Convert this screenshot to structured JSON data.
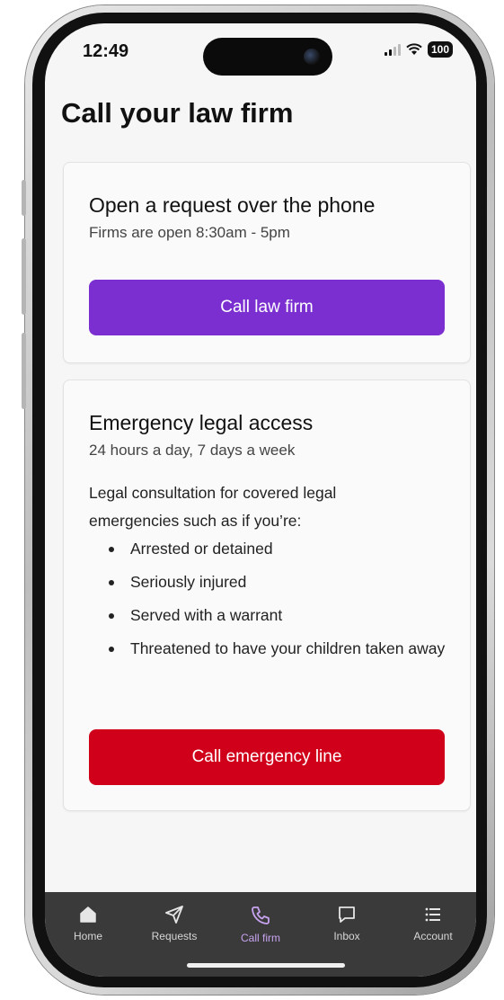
{
  "status_bar": {
    "time": "12:49",
    "battery": "100"
  },
  "page": {
    "title": "Call your law firm"
  },
  "phone_card": {
    "title": "Open a request over the phone",
    "subtitle": "Firms are open 8:30am - 5pm",
    "button_label": "Call law firm"
  },
  "emergency_card": {
    "title": "Emergency legal access",
    "subtitle": "24 hours a day, 7 days a week",
    "description": "Legal consultation for covered legal emergencies such as if you’re:",
    "bullets": [
      "Arrested or detained",
      "Seriously injured",
      "Served with a warrant",
      "Threatened to have your children taken away"
    ],
    "button_label": "Call emergency line"
  },
  "tab_bar": {
    "tabs": [
      {
        "label": "Home",
        "icon": "home-icon"
      },
      {
        "label": "Requests",
        "icon": "send-icon"
      },
      {
        "label": "Call firm",
        "icon": "phone-icon",
        "active": true
      },
      {
        "label": "Inbox",
        "icon": "chat-icon"
      },
      {
        "label": "Account",
        "icon": "list-icon"
      }
    ]
  },
  "colors": {
    "primary_purple": "#7b2fd1",
    "emergency_red": "#d0001b",
    "active_tab": "#c7a3ef",
    "tab_bar_bg": "#3a3a3a"
  }
}
